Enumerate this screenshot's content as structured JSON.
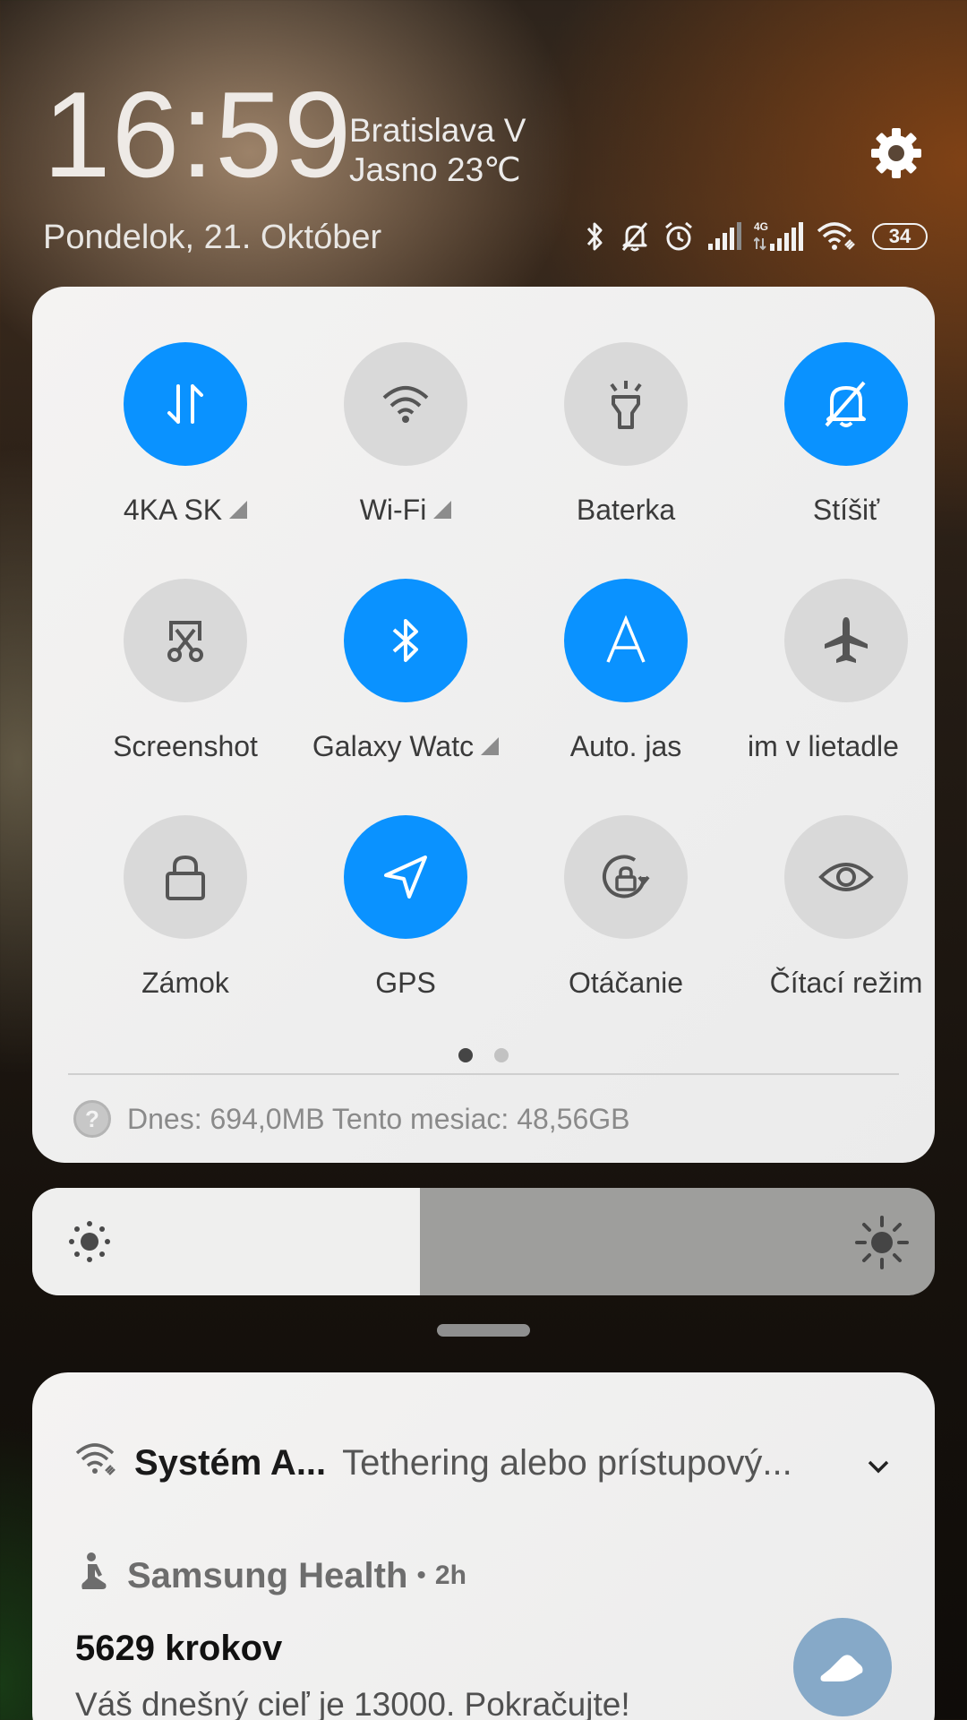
{
  "header": {
    "time": "16:59",
    "location": "Bratislava V",
    "weather": "Jasno 23℃",
    "date": "Pondelok, 21. Október",
    "settings_icon": "gear-icon",
    "battery_level": "34",
    "status_icons": [
      "bluetooth-icon",
      "mute-icon",
      "alarm-icon",
      "signal-icon",
      "signal-4g-icon",
      "wifi-icon",
      "battery-icon"
    ]
  },
  "quick_settings": {
    "active_color": "#0a92ff",
    "tiles": [
      {
        "label": "4KA SK",
        "icon": "mobile-data-icon",
        "active": true,
        "dropdown": true
      },
      {
        "label": "Wi-Fi",
        "icon": "wifi-icon",
        "active": false,
        "dropdown": true
      },
      {
        "label": "Baterka",
        "icon": "flashlight-icon",
        "active": false
      },
      {
        "label": "Stíšiť",
        "icon": "mute-icon",
        "active": true
      },
      {
        "label": "Screenshot",
        "icon": "screenshot-icon",
        "active": false
      },
      {
        "label": "Galaxy Watc",
        "icon": "bluetooth-icon",
        "active": true,
        "dropdown": true
      },
      {
        "label": "Auto. jas",
        "icon": "auto-brightness-icon",
        "active": true
      },
      {
        "label": "im v lietadle",
        "icon": "airplane-icon",
        "active": false
      },
      {
        "label": "Zámok",
        "icon": "lock-icon",
        "active": false
      },
      {
        "label": "GPS",
        "icon": "location-icon",
        "active": true
      },
      {
        "label": "Otáčanie",
        "icon": "rotation-lock-icon",
        "active": false
      },
      {
        "label": "Čítací režim",
        "icon": "eye-icon",
        "active": false
      }
    ],
    "page_current": 1,
    "page_count": 2,
    "data_usage": "Dnes: 694,0MB Tento mesiac: 48,56GB"
  },
  "brightness": {
    "level": 0.43
  },
  "notifications": {
    "system": {
      "app": "Systém A...",
      "text": "Tethering alebo prístupový...",
      "icon": "wifi-tethering-icon"
    },
    "health": {
      "app": "Samsung Health",
      "separator": "•",
      "time": "2h",
      "title": "5629 krokov",
      "body": "Váš dnešný cieľ je 13000. Pokračujte!",
      "icon": "walking-icon",
      "action_icon": "shoe-icon"
    }
  }
}
